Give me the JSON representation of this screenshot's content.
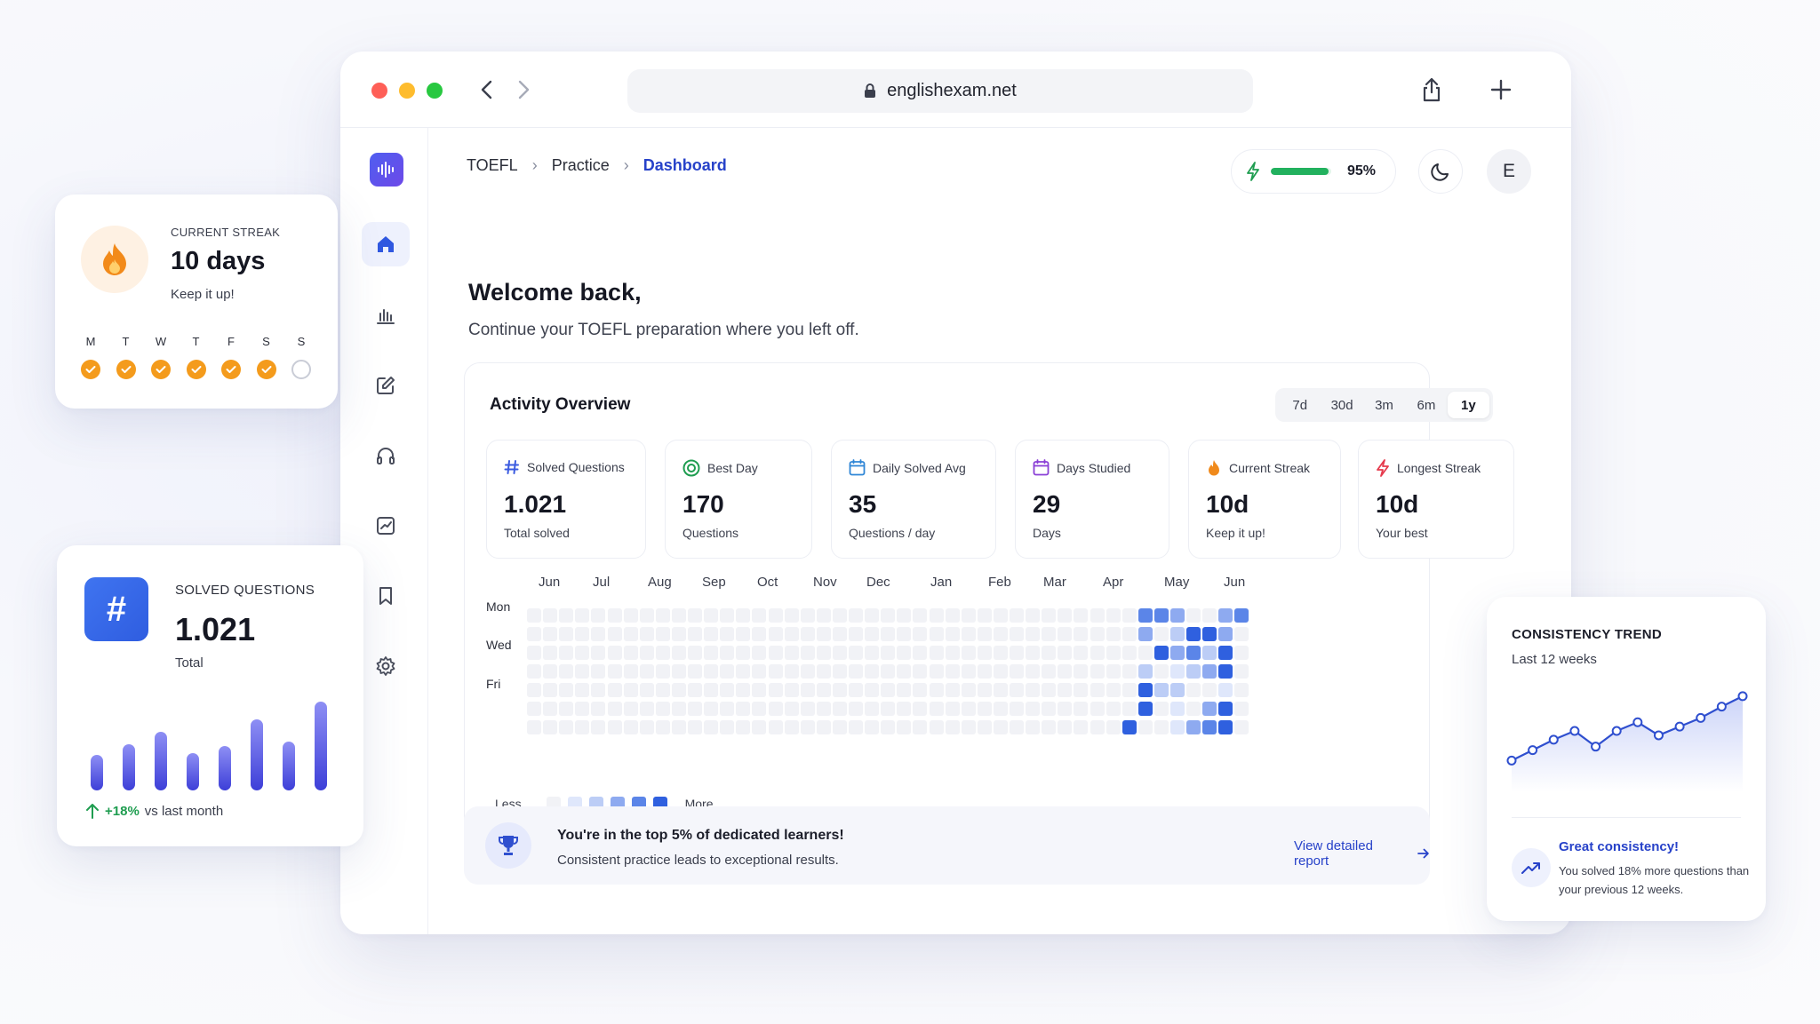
{
  "browser": {
    "url": "englishexam.net"
  },
  "breadcrumb": [
    "TOEFL",
    "Practice",
    "Dashboard"
  ],
  "header": {
    "xp_percent_label": "95%",
    "xp_fraction": 0.95,
    "avatar_initial": "E"
  },
  "welcome": {
    "title": "Welcome back,",
    "subtitle": "Continue your TOEFL preparation where you left off."
  },
  "activity": {
    "title": "Activity Overview",
    "ranges": [
      "7d",
      "30d",
      "3m",
      "6m",
      "1y"
    ],
    "selected_range": "1y",
    "stats": [
      {
        "icon": "hash-icon",
        "label": "Solved Questions",
        "value": "1.021",
        "sub": "Total solved",
        "color": "#3b5be0"
      },
      {
        "icon": "target-icon",
        "label": "Best Day",
        "value": "170",
        "sub": "Questions",
        "color": "#1f9d50"
      },
      {
        "icon": "calendar-icon",
        "label": "Daily Solved Avg",
        "value": "35",
        "sub": "Questions / day",
        "color": "#2f86d6"
      },
      {
        "icon": "calendar-icon",
        "label": "Days Studied",
        "value": "29",
        "sub": "Days",
        "color": "#8a3fd6"
      },
      {
        "icon": "flame-icon",
        "label": "Current Streak",
        "value": "10d",
        "sub": "Keep it up!",
        "color": "#f08a1c"
      },
      {
        "icon": "bolt-icon",
        "label": "Longest Streak",
        "value": "10d",
        "sub": "Your best",
        "color": "#e63b4d"
      }
    ],
    "heatmap": {
      "months": [
        "Jun",
        "Jul",
        "Aug",
        "Sep",
        "Oct",
        "Nov",
        "Dec",
        "Jan",
        "Feb",
        "Mar",
        "Apr",
        "May",
        "Jun"
      ],
      "day_labels": [
        "Mon",
        "Wed",
        "Fri"
      ],
      "legend_less": "Less",
      "legend_more": "More",
      "levels": [
        "#f1f2f6",
        "#dfe7fb",
        "#bccdf6",
        "#8eaaf0",
        "#5b85e8",
        "#2f60df"
      ],
      "active_cells": [
        {
          "week": 38,
          "day": 0,
          "level": 4
        },
        {
          "week": 39,
          "day": 0,
          "level": 4
        },
        {
          "week": 40,
          "day": 0,
          "level": 3
        },
        {
          "week": 43,
          "day": 0,
          "level": 3
        },
        {
          "week": 44,
          "day": 0,
          "level": 4
        },
        {
          "week": 38,
          "day": 1,
          "level": 3
        },
        {
          "week": 40,
          "day": 1,
          "level": 2
        },
        {
          "week": 41,
          "day": 1,
          "level": 5
        },
        {
          "week": 42,
          "day": 1,
          "level": 5
        },
        {
          "week": 43,
          "day": 1,
          "level": 3
        },
        {
          "week": 39,
          "day": 2,
          "level": 5
        },
        {
          "week": 40,
          "day": 2,
          "level": 3
        },
        {
          "week": 41,
          "day": 2,
          "level": 4
        },
        {
          "week": 42,
          "day": 2,
          "level": 2
        },
        {
          "week": 43,
          "day": 2,
          "level": 5
        },
        {
          "week": 38,
          "day": 3,
          "level": 2
        },
        {
          "week": 40,
          "day": 3,
          "level": 1
        },
        {
          "week": 41,
          "day": 3,
          "level": 2
        },
        {
          "week": 42,
          "day": 3,
          "level": 3
        },
        {
          "week": 43,
          "day": 3,
          "level": 5
        },
        {
          "week": 38,
          "day": 4,
          "level": 5
        },
        {
          "week": 39,
          "day": 4,
          "level": 2
        },
        {
          "week": 40,
          "day": 4,
          "level": 2
        },
        {
          "week": 43,
          "day": 4,
          "level": 1
        },
        {
          "week": 38,
          "day": 5,
          "level": 5
        },
        {
          "week": 40,
          "day": 5,
          "level": 1
        },
        {
          "week": 42,
          "day": 5,
          "level": 3
        },
        {
          "week": 43,
          "day": 5,
          "level": 5
        },
        {
          "week": 37,
          "day": 6,
          "level": 5
        },
        {
          "week": 40,
          "day": 6,
          "level": 1
        },
        {
          "week": 41,
          "day": 6,
          "level": 3
        },
        {
          "week": 42,
          "day": 6,
          "level": 4
        },
        {
          "week": 43,
          "day": 6,
          "level": 5
        }
      ]
    }
  },
  "banner": {
    "title": "You're in the top 5% of dedicated learners!",
    "subtitle": "Consistent practice leads to exceptional results.",
    "link": "View detailed report"
  },
  "streak_card": {
    "label": "CURRENT STREAK",
    "value": "10 days",
    "sub": "Keep it up!",
    "days": [
      "M",
      "T",
      "W",
      "T",
      "F",
      "S",
      "S"
    ],
    "done": [
      true,
      true,
      true,
      true,
      true,
      true,
      false
    ]
  },
  "solved_card": {
    "label": "SOLVED QUESTIONS",
    "value": "1.021",
    "sub": "Total",
    "bars": [
      0.4,
      0.52,
      0.66,
      0.42,
      0.5,
      0.8,
      0.55,
      1.0
    ],
    "trend_value": "+18%",
    "trend_text": "vs last month"
  },
  "trend_card": {
    "title": "CONSISTENCY TREND",
    "subtitle": "Last 12 weeks",
    "points": [
      0.18,
      0.3,
      0.42,
      0.52,
      0.34,
      0.52,
      0.62,
      0.47,
      0.57,
      0.67,
      0.8,
      0.92
    ],
    "msg_title": "Great consistency!",
    "msg": "You solved 18% more questions than your previous 12 weeks."
  },
  "colors": {
    "accent": "#2742c9",
    "success": "#1f9d50",
    "streak": "#f49b1c"
  }
}
